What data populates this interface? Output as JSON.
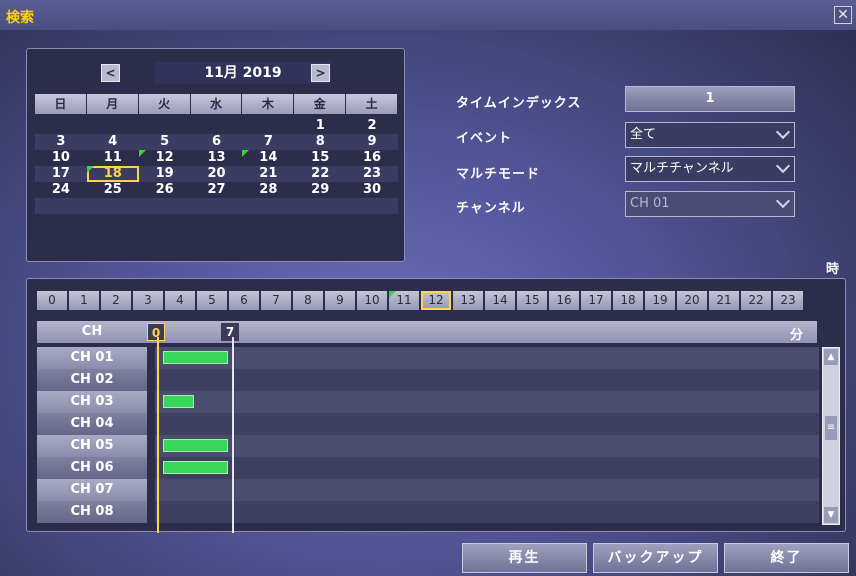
{
  "window": {
    "title": "検索",
    "close_label": "✕"
  },
  "calendar": {
    "prev_label": "<",
    "next_label": ">",
    "month_label": "11月 2019",
    "weekdays": [
      "日",
      "月",
      "火",
      "水",
      "木",
      "金",
      "土"
    ],
    "weeks": [
      [
        "",
        "",
        "",
        "",
        "",
        "1",
        "2"
      ],
      [
        "3",
        "4",
        "5",
        "6",
        "7",
        "8",
        "9"
      ],
      [
        "10",
        "11",
        "12",
        "13",
        "14",
        "15",
        "16"
      ],
      [
        "17",
        "18",
        "19",
        "20",
        "21",
        "22",
        "23"
      ],
      [
        "24",
        "25",
        "26",
        "27",
        "28",
        "29",
        "30"
      ],
      [
        "",
        "",
        "",
        "",
        "",
        "",
        ""
      ]
    ],
    "selected_day": "18",
    "event_days": [
      "12",
      "14",
      "18"
    ]
  },
  "form": {
    "time_index_label": "タイムインデックス",
    "time_index_value": "1",
    "event_label": "イベント",
    "event_value": "全て",
    "multi_mode_label": "マルチモード",
    "multi_mode_value": "マルチチャンネル",
    "channel_label": "チャンネル",
    "channel_value": "CH 01"
  },
  "timeline": {
    "hour_unit": "時",
    "hours": [
      "0",
      "1",
      "2",
      "3",
      "4",
      "5",
      "6",
      "7",
      "8",
      "9",
      "10",
      "11",
      "12",
      "13",
      "14",
      "15",
      "16",
      "17",
      "18",
      "19",
      "20",
      "21",
      "22",
      "23"
    ],
    "current_hour": "12",
    "event_hours": [
      "11"
    ],
    "ch_header": "CH",
    "minute_unit": "分",
    "marker_start": "0",
    "marker_end": "7",
    "channels": [
      {
        "name": "CH 01",
        "recording": [
          1,
          6
        ]
      },
      {
        "name": "CH 02",
        "recording": []
      },
      {
        "name": "CH 03",
        "recording": [
          1,
          3
        ]
      },
      {
        "name": "CH 04",
        "recording": []
      },
      {
        "name": "CH 05",
        "recording": [
          1,
          6
        ]
      },
      {
        "name": "CH 06",
        "recording": [
          1,
          6
        ]
      },
      {
        "name": "CH 07",
        "recording": []
      },
      {
        "name": "CH 08",
        "recording": []
      }
    ]
  },
  "buttons": {
    "play": "再生",
    "backup": "バックアップ",
    "exit": "終了"
  },
  "colors": {
    "accent": "#ffd44a",
    "recording": "#39d65a",
    "title": "#ffd300"
  }
}
